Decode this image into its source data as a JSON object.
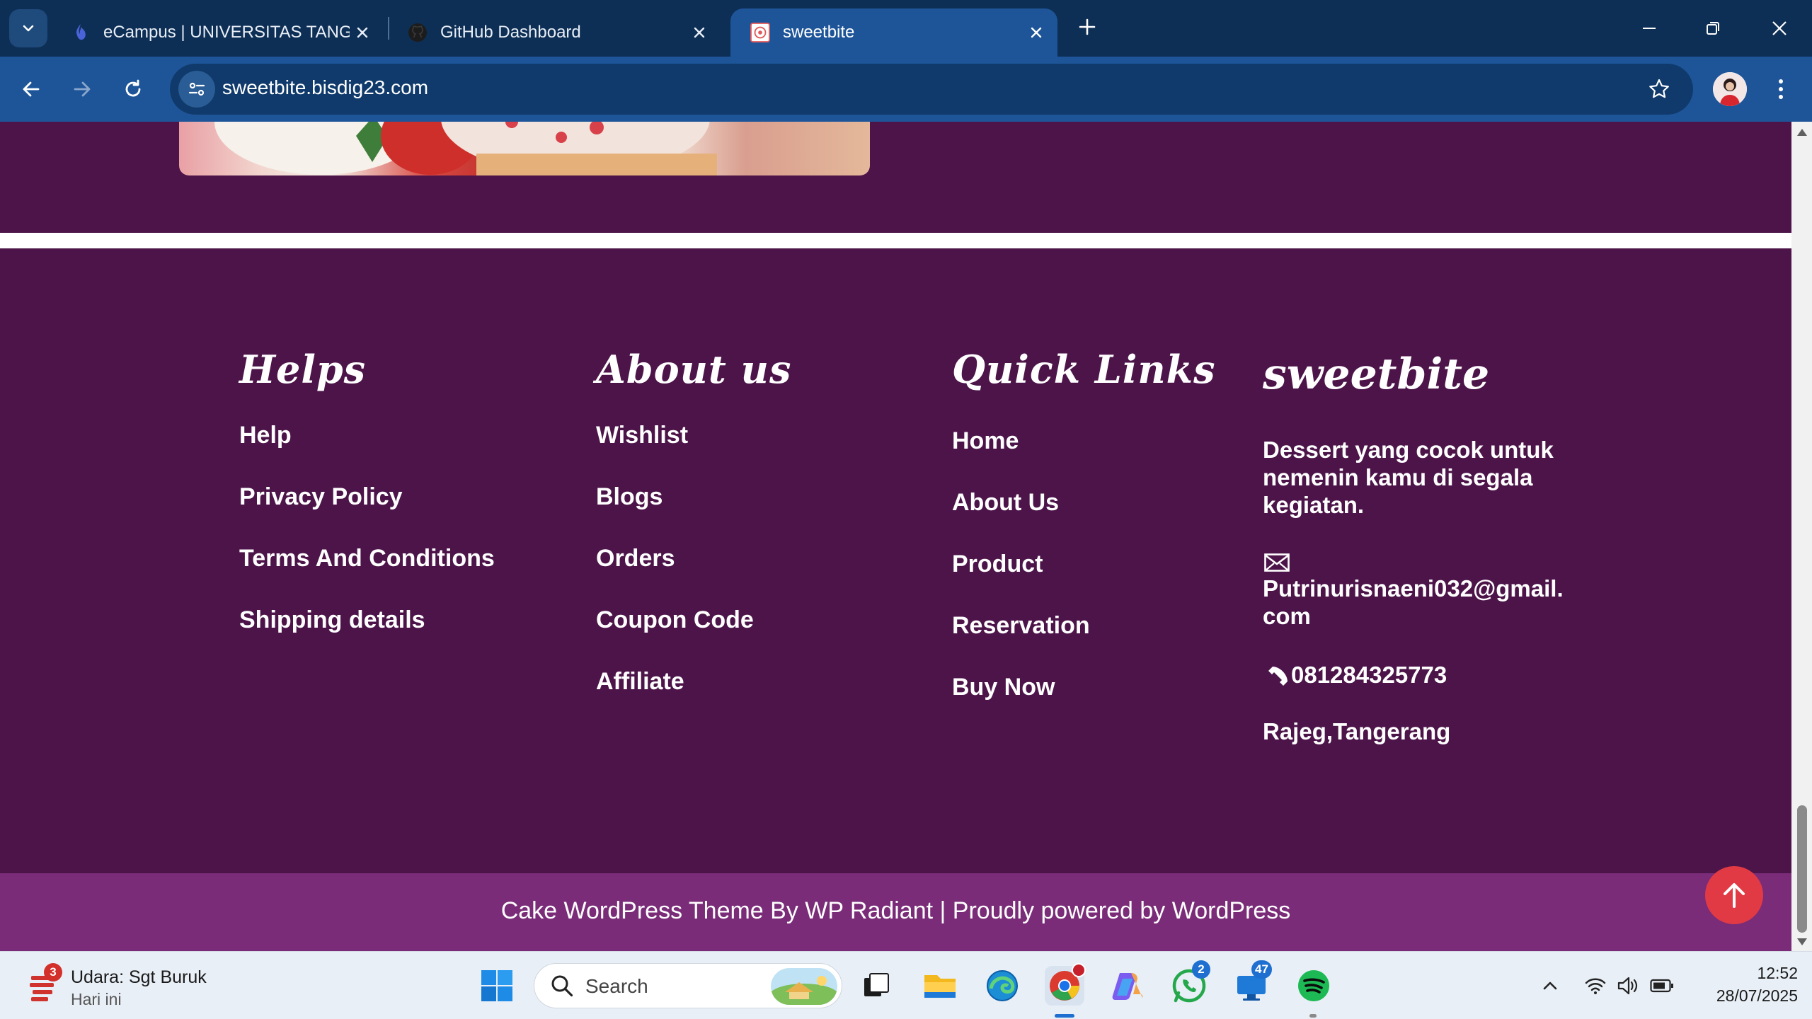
{
  "browser": {
    "tabs": [
      {
        "title": "eCampus | UNIVERSITAS TANGE",
        "favicon": "ecampus-flame-icon",
        "active": false
      },
      {
        "title": "GitHub Dashboard",
        "favicon": "github-icon",
        "active": false
      },
      {
        "title": "sweetbite",
        "favicon": "sweetbite-favicon",
        "active": true
      }
    ],
    "url": "sweetbite.bisdig23.com"
  },
  "footer": {
    "helps": {
      "title": "Helps",
      "links": [
        "Help",
        "Privacy Policy",
        "Terms And Conditions",
        "Shipping details"
      ]
    },
    "about": {
      "title": "About us",
      "links": [
        "Wishlist",
        "Blogs",
        "Orders",
        "Coupon Code",
        "Affiliate"
      ]
    },
    "quick_links": {
      "title": "Quick Links",
      "links": [
        "Home",
        "About Us",
        "Product",
        "Reservation",
        "Buy Now"
      ]
    },
    "brand": {
      "title": "sweetbite",
      "tagline_lines": [
        "Dessert yang cocok untuk",
        "nemenin kamu di segala",
        "kegiatan."
      ],
      "email_lines": [
        "Putrinurisnaeni032@gmail.",
        "com"
      ],
      "phone": "081284325773",
      "address": "Rajeg,Tangerang"
    },
    "copyright": "Cake WordPress Theme By WP Radiant | Proudly powered by WordPress"
  },
  "taskbar": {
    "weather": {
      "title": "Udara: Sgt Buruk",
      "subtitle": "Hari ini",
      "badge": "3"
    },
    "search_label": "Search",
    "whatsapp_badge": "2",
    "remote_badge": "47",
    "time": "12:52",
    "date": "28/07/2025"
  },
  "colors": {
    "page_bg": "#4c1449",
    "copyright_bg": "#7a2c78",
    "to_top_button": "#e23a44",
    "browser_frame": "#0e2f55",
    "toolbar": "#1e5599"
  }
}
